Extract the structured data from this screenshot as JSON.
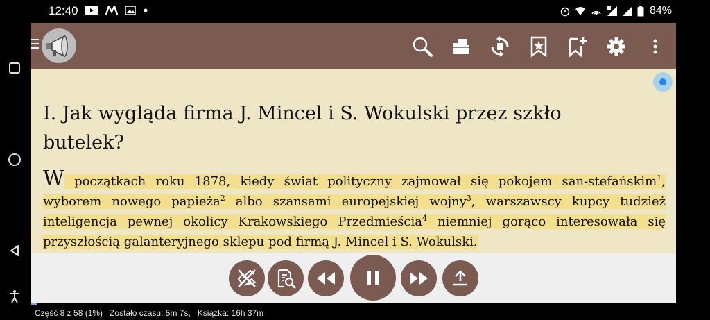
{
  "status": {
    "time": "12:40",
    "battery": "84%"
  },
  "toolbar": {
    "icons": [
      "search-icon",
      "folder-icon",
      "sync-icon",
      "bookmarks-icon",
      "add-bookmark-icon",
      "settings-icon",
      "more-icon"
    ]
  },
  "book": {
    "chapter_title": "I. Jak wygląda firma J. Mincel i S. Wokulski przez szkło butelek?",
    "drop_cap": "W",
    "p1": " początkach roku 1878, kiedy świat polityczny zajmował się pokojem san-stefańskim",
    "fn1": "1",
    "p2": ", wyborem nowego papieża",
    "fn2": "2",
    "p3": " albo szansami europejskiej wojny",
    "fn3": "3",
    "p4": ", warszawscy kupcy tudzież inteligencja pewnej okolicy Krakowskiego Przedmieścia",
    "fn4": "4",
    "p5": " niemniej gorąco interesowała się przyszłością galanteryjnego sklepu pod firmą J. Mincel i S. Wokulski."
  },
  "player": {
    "state": "playing"
  },
  "footer": {
    "part": "Część 8 z 58 (1%)",
    "time_left": "Zostało czasu: 5m 7s,",
    "book_time": "Książka: 16h 37m",
    "progress_fraction": 0.01
  },
  "colors": {
    "toolbar": "#7b5a52",
    "page_bg": "#efe6c6",
    "highlight": "#f3df8e",
    "player_bg": "#efefef"
  }
}
